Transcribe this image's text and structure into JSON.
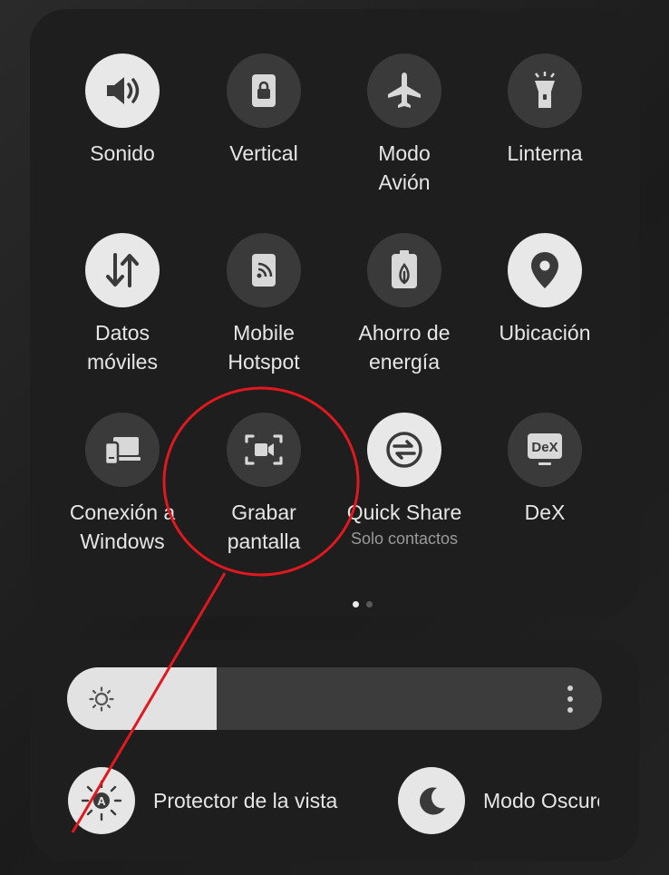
{
  "tiles": [
    {
      "label": "Sonido",
      "state": "on",
      "icon": "sound-icon"
    },
    {
      "label": "Vertical",
      "state": "off",
      "icon": "lock-rotation-icon"
    },
    {
      "label": "Modo\nAvión",
      "state": "off",
      "icon": "airplane-icon"
    },
    {
      "label": "Linterna",
      "state": "off",
      "icon": "flashlight-icon"
    },
    {
      "label": "Datos\nmóviles",
      "state": "on",
      "icon": "mobile-data-icon"
    },
    {
      "label": "Mobile\nHotspot",
      "state": "off",
      "icon": "hotspot-icon"
    },
    {
      "label": "Ahorro de\nenergía",
      "state": "off",
      "icon": "battery-saver-icon"
    },
    {
      "label": "Ubicación",
      "state": "on",
      "icon": "location-icon"
    },
    {
      "label": "Conexión a\nWindows",
      "state": "off",
      "icon": "link-to-windows-icon"
    },
    {
      "label": "Grabar\npantalla",
      "state": "off",
      "icon": "screen-record-icon"
    },
    {
      "label": "Quick Share",
      "sublabel": "Solo contactos",
      "state": "on",
      "icon": "quick-share-icon"
    },
    {
      "label": "DeX",
      "state": "off",
      "icon": "dex-icon",
      "icon_text": "DeX"
    }
  ],
  "pagination": {
    "pages": 2,
    "active": 1
  },
  "brightness": {
    "level": 0.28,
    "icon": "sun-icon",
    "menu_icon": "more-vertical-icon"
  },
  "bottom_toggles": [
    {
      "label": "Protector de la vista",
      "icon": "eye-comfort-icon",
      "icon_text": "A",
      "state": "on"
    },
    {
      "label": "Modo Oscuro",
      "icon": "moon-icon",
      "state": "on"
    }
  ],
  "colors": {
    "on": "#e8e8e8",
    "off": "#3a3a3a",
    "annotation": "#e0181f"
  }
}
